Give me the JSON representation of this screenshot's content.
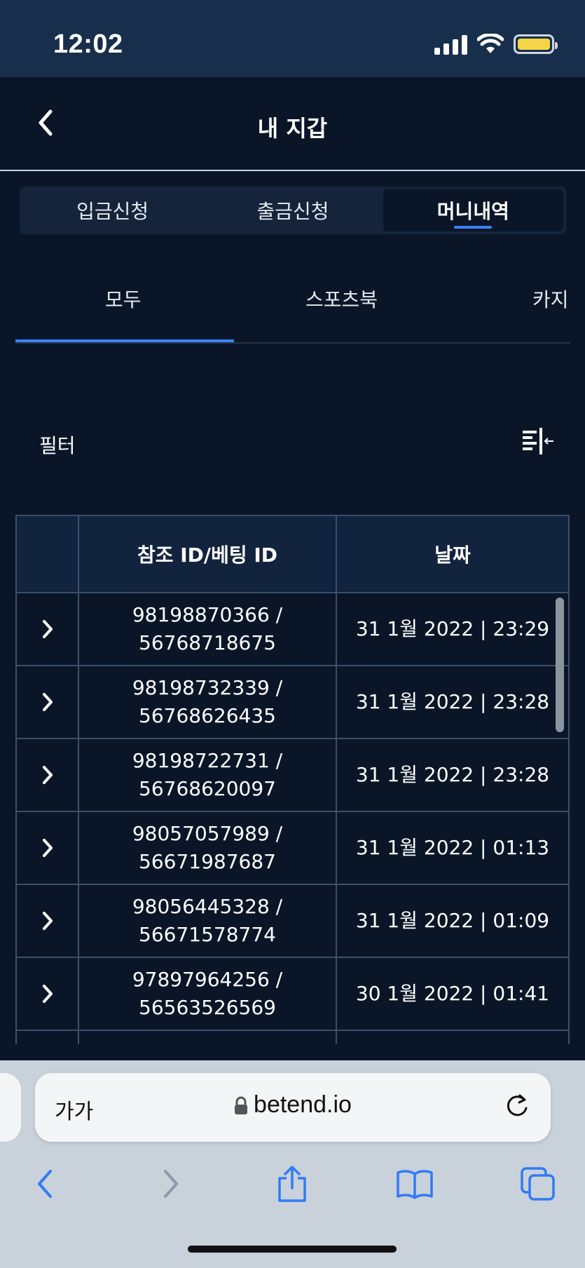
{
  "status_bar": {
    "time": "12:02"
  },
  "header": {
    "title": "내 지갑"
  },
  "main_tabs": [
    {
      "label": "입금신청"
    },
    {
      "label": "출금신청"
    },
    {
      "label": "머니내역"
    }
  ],
  "sub_tabs": [
    {
      "label": "모두"
    },
    {
      "label": "스포츠북"
    },
    {
      "label": "카지"
    }
  ],
  "filter": {
    "label": "필터"
  },
  "table": {
    "headers": [
      "",
      "참조 ID/베팅 ID",
      "날짜"
    ],
    "rows": [
      {
        "ref_id": "98198870366 /",
        "bet_id": "56768718675",
        "date": "31 1월 2022 | 23:29"
      },
      {
        "ref_id": "98198732339 /",
        "bet_id": "56768626435",
        "date": "31 1월 2022 | 23:28"
      },
      {
        "ref_id": "98198722731 /",
        "bet_id": "56768620097",
        "date": "31 1월 2022 | 23:28"
      },
      {
        "ref_id": "98057057989 /",
        "bet_id": "56671987687",
        "date": "31 1월 2022 | 01:13"
      },
      {
        "ref_id": "98056445328 /",
        "bet_id": "56671578774",
        "date": "31 1월 2022 | 01:09"
      },
      {
        "ref_id": "97897964256 /",
        "bet_id": "56563526569",
        "date": "30 1월 2022 | 01:41"
      }
    ]
  },
  "browser": {
    "text_size_label": "가가",
    "url": "betend.io"
  },
  "colors": {
    "accent": "#3b82f6",
    "background": "#0a1628",
    "header_row": "#12233e"
  }
}
